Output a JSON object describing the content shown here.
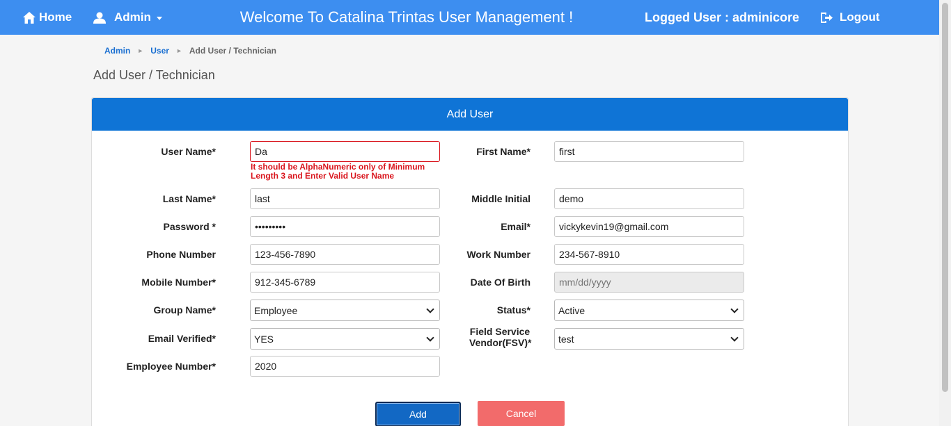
{
  "nav": {
    "home": "Home",
    "admin": "Admin",
    "title": "Welcome To Catalina Trintas User Management !",
    "logged_user": "Logged User : adminicore",
    "logout": "Logout"
  },
  "breadcrumb": {
    "admin": "Admin",
    "separator": "►",
    "user": "User",
    "current": "Add User / Technician"
  },
  "page_title": "Add User / Technician",
  "card_title": "Add User",
  "form": {
    "user_name": {
      "label": "User Name*",
      "value": "Da",
      "error": "It should be AlphaNumeric only of Minimum Length 3 and Enter Valid User Name"
    },
    "first_name": {
      "label": "First Name*",
      "value": "first"
    },
    "last_name": {
      "label": "Last Name*",
      "value": "last"
    },
    "middle_initial": {
      "label": "Middle Initial",
      "value": "demo"
    },
    "password": {
      "label": "Password *",
      "value": "•••••••••"
    },
    "email": {
      "label": "Email*",
      "value": "vickykevin19@gmail.com"
    },
    "phone_number": {
      "label": "Phone Number",
      "value": "123-456-7890"
    },
    "work_number": {
      "label": "Work Number",
      "value": "234-567-8910"
    },
    "mobile_number": {
      "label": "Mobile Number*",
      "value": "912-345-6789"
    },
    "date_of_birth": {
      "label": "Date Of Birth",
      "placeholder": "mm/dd/yyyy"
    },
    "group_name": {
      "label": "Group Name*",
      "value": "Employee"
    },
    "status": {
      "label": "Status*",
      "value": "Active"
    },
    "email_verified": {
      "label": "Email Verified*",
      "value": "YES"
    },
    "fsv": {
      "label_line1": "Field Service",
      "label_line2": "Vendor(FSV)*",
      "value": "test"
    },
    "employee_number": {
      "label": "Employee Number*",
      "value": "2020"
    }
  },
  "buttons": {
    "add": "Add",
    "cancel": "Cancel"
  }
}
